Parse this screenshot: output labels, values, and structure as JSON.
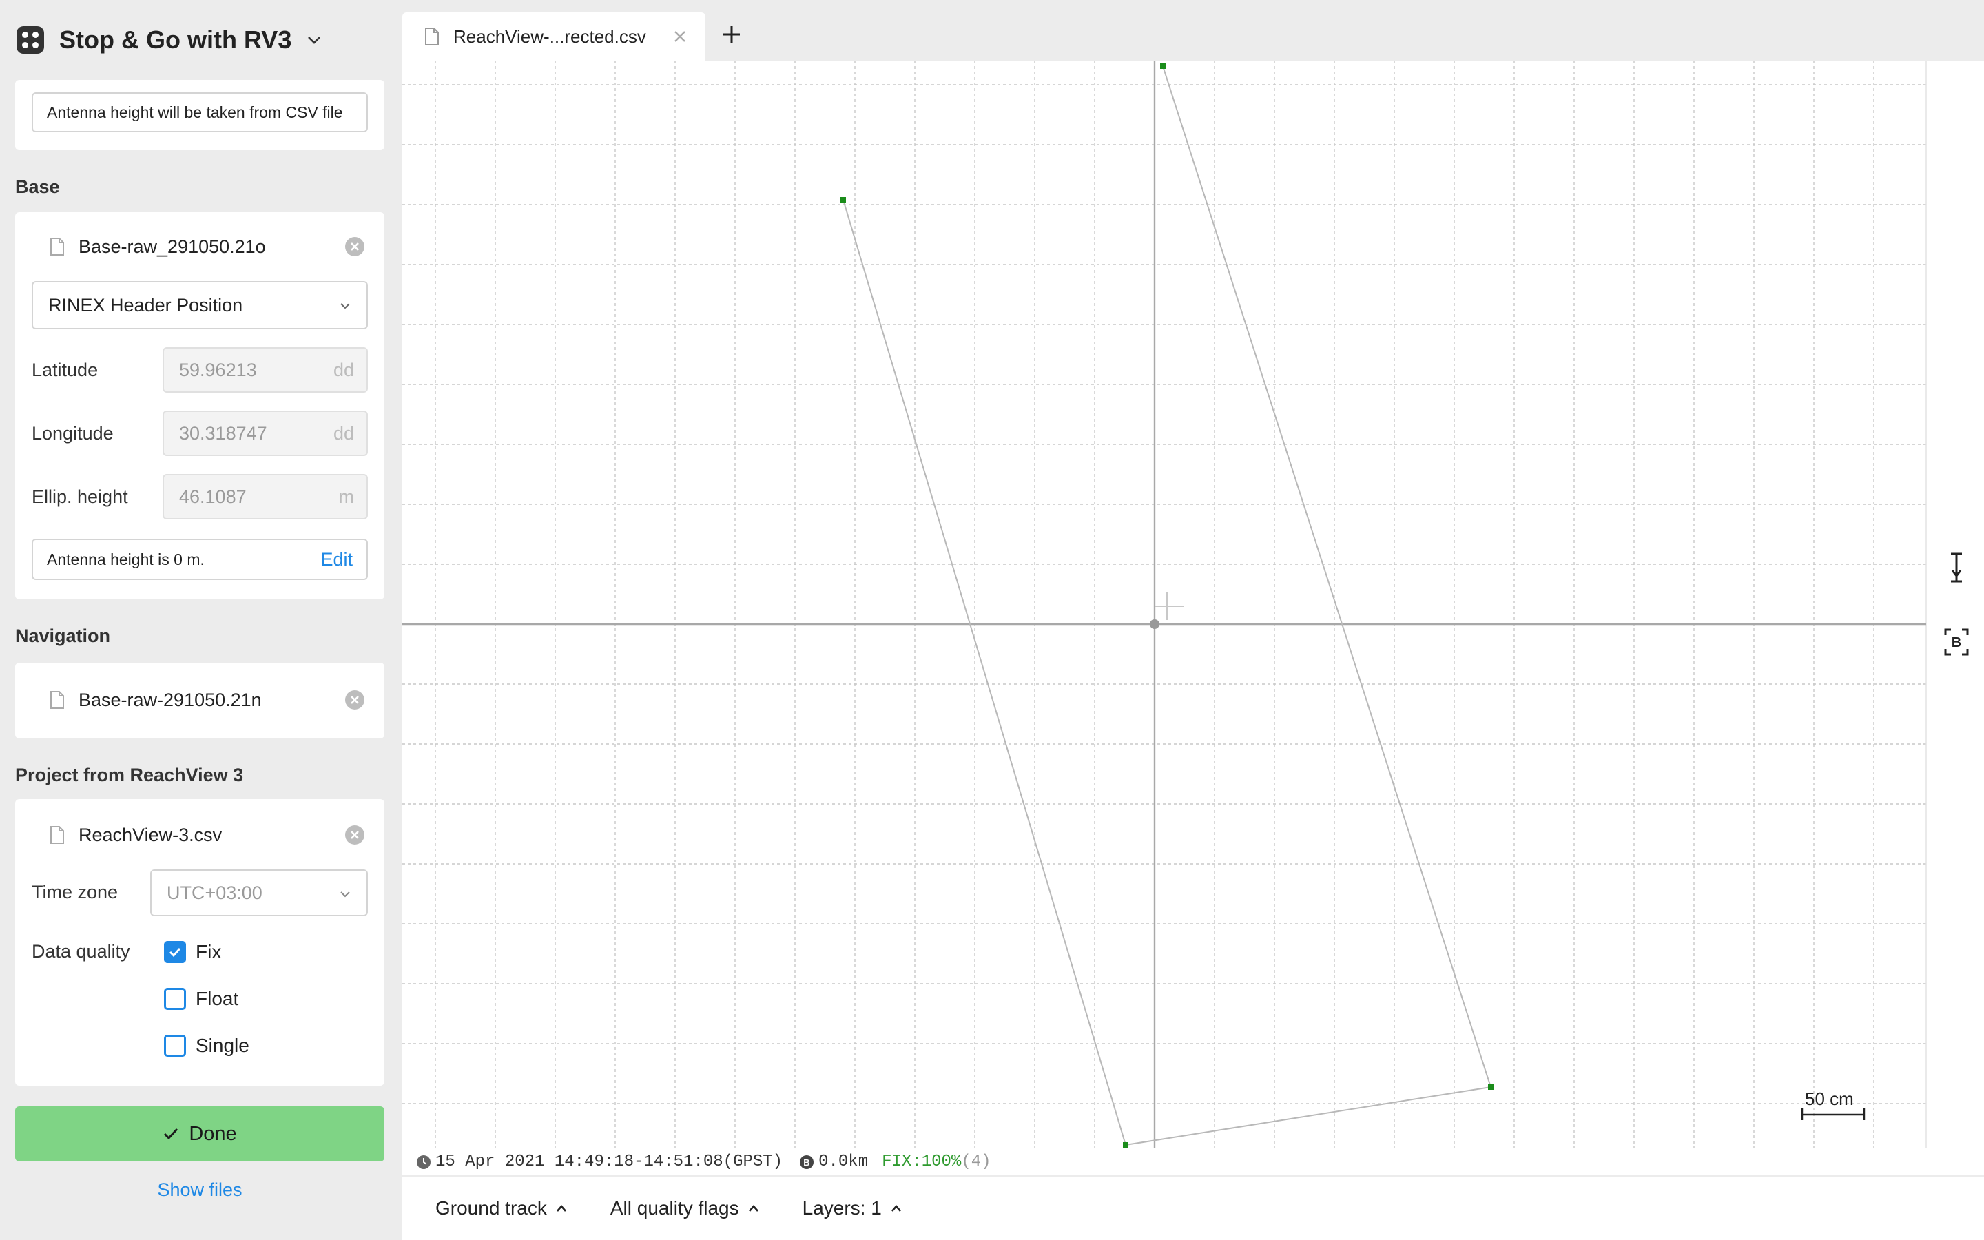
{
  "app": {
    "title": "Stop & Go with RV3"
  },
  "rover": {
    "antenna_note": "Antenna height will be taken from CSV file"
  },
  "base": {
    "section_label": "Base",
    "file_name": "Base-raw_291050.21o",
    "position_source": "RINEX Header Position",
    "latitude_label": "Latitude",
    "latitude_value": "59.96213",
    "latitude_unit": "dd",
    "longitude_label": "Longitude",
    "longitude_value": "30.318747",
    "longitude_unit": "dd",
    "height_label": "Ellip. height",
    "height_value": "46.1087",
    "height_unit": "m",
    "antenna_note": "Antenna height is 0 m.",
    "edit_label": "Edit"
  },
  "navigation": {
    "section_label": "Navigation",
    "file_name": "Base-raw-291050.21n"
  },
  "project": {
    "section_label": "Project from ReachView 3",
    "file_name": "ReachView-3.csv",
    "timezone_label": "Time zone",
    "timezone_value": "UTC+03:00",
    "quality_label": "Data quality",
    "quality_options": [
      {
        "label": "Fix",
        "checked": true
      },
      {
        "label": "Float",
        "checked": false
      },
      {
        "label": "Single",
        "checked": false
      }
    ]
  },
  "actions": {
    "done_label": "Done",
    "show_files_label": "Show files"
  },
  "tab": {
    "label": "ReachView-...rected.csv"
  },
  "map": {
    "scale_label": "50 cm",
    "track_color": "#1a8c1a"
  },
  "status": {
    "time_range": "15 Apr 2021 14:49:18-14:51:08(GPST)",
    "distance": "0.0km",
    "fix_text": "FIX:100%",
    "fix_count": "(4)"
  },
  "bottom": {
    "ground_track_label": "Ground track",
    "quality_flags_label": "All quality flags",
    "layers_label": "Layers: 1"
  }
}
